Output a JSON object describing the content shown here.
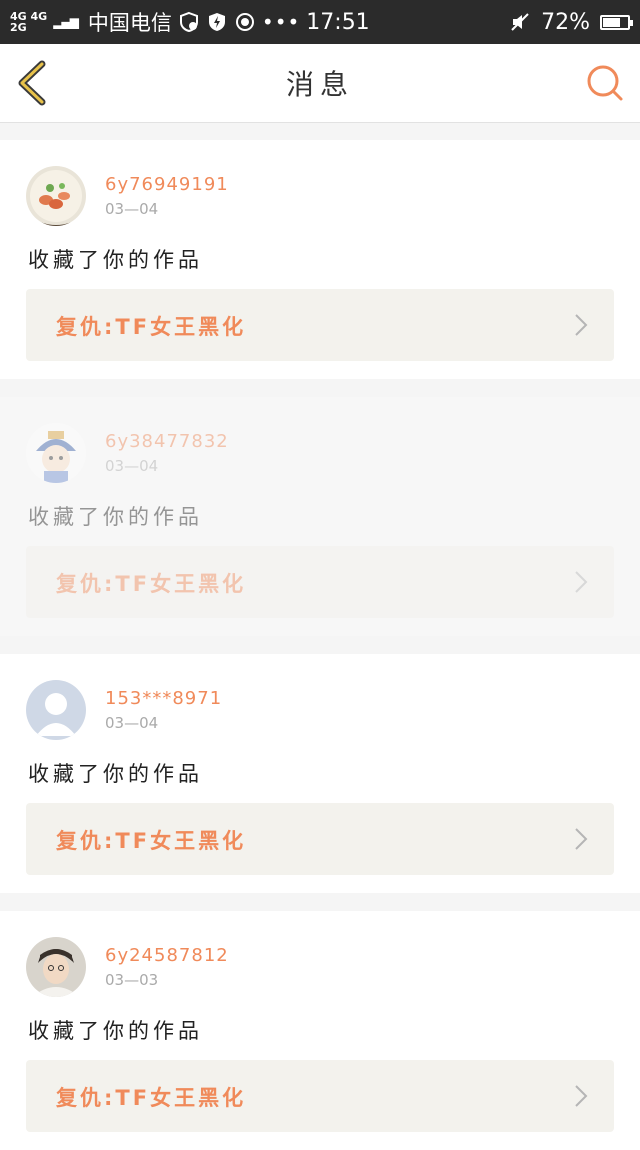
{
  "status_bar": {
    "network_top": "4G 4G",
    "network_bottom": "2G",
    "carrier": "中国电信",
    "dots": "•••",
    "time": "17:51",
    "battery": "72%",
    "battery_level": 0.72
  },
  "header": {
    "title": "消息"
  },
  "colors": {
    "accent": "#f08a5a",
    "card_box": "#f3f2ed"
  },
  "messages": [
    {
      "username": "6y76949191",
      "date": "03—04",
      "action": "收藏了你的作品",
      "work": "复仇:TF女王黑化",
      "avatar": "food-photo-icon"
    },
    {
      "username": "6y38477832",
      "date": "03—04",
      "action": "收藏了你的作品",
      "work": "复仇:TF女王黑化",
      "avatar": "cartoon-character-icon"
    },
    {
      "username": "153***8971",
      "date": "03—04",
      "action": "收藏了你的作品",
      "work": "复仇:TF女王黑化",
      "avatar": "default-user-icon"
    },
    {
      "username": "6y24587812",
      "date": "03—03",
      "action": "收藏了你的作品",
      "work": "复仇:TF女王黑化",
      "avatar": "person-photo-icon"
    }
  ]
}
